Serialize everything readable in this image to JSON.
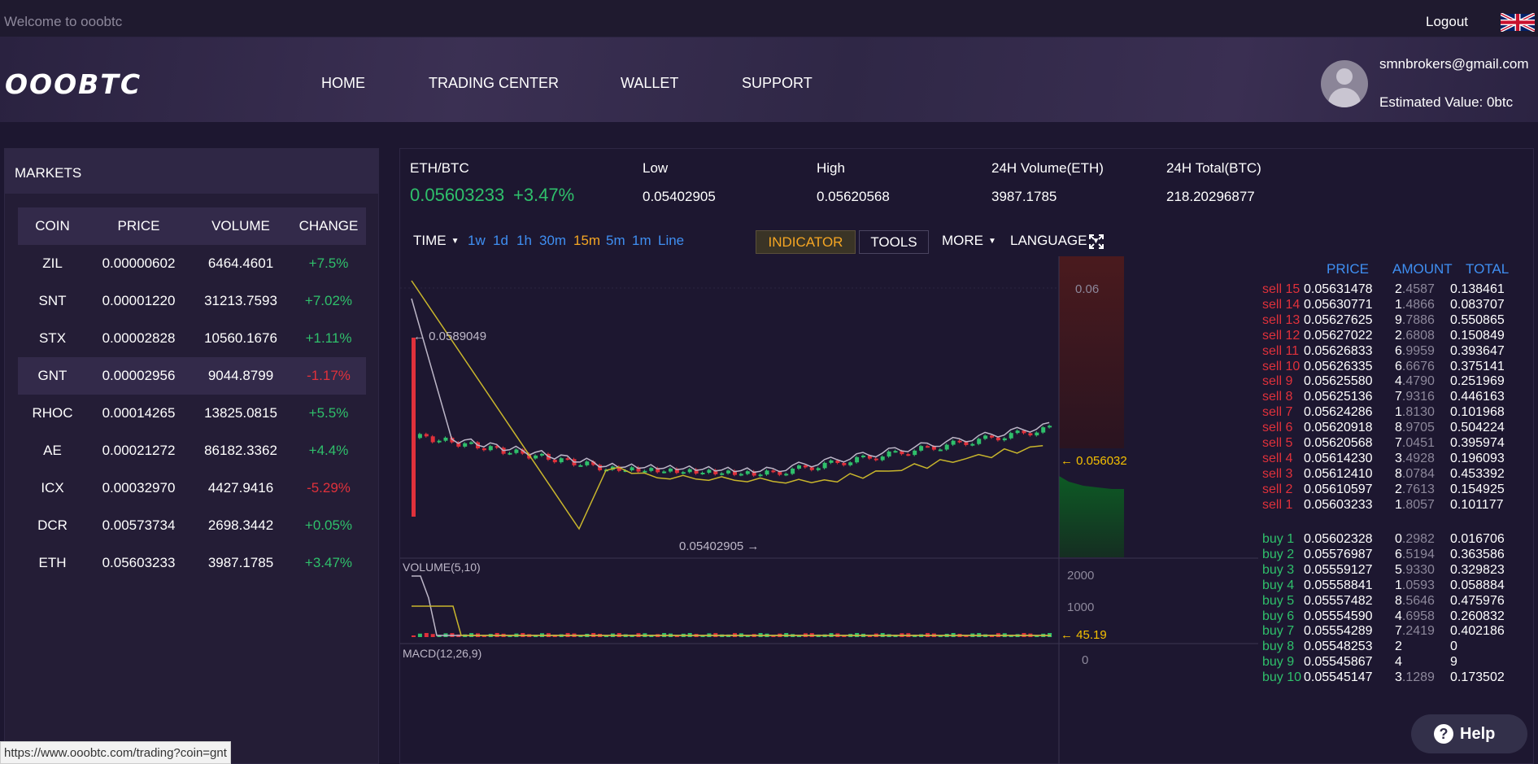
{
  "topbar": {
    "welcome": "Welcome to ooobtc",
    "logout": "Logout"
  },
  "nav": {
    "logo": "OOOBTC",
    "items": [
      "HOME",
      "TRADING CENTER",
      "WALLET",
      "SUPPORT"
    ],
    "user_email": "smnbrokers@gmail.com",
    "estimated_value": "Estimated Value: 0btc"
  },
  "markets": {
    "title": "MARKETS",
    "headers": [
      "COIN",
      "PRICE",
      "VOLUME",
      "CHANGE"
    ],
    "rows": [
      {
        "coin": "ZIL",
        "price": "0.00000602",
        "volume": "6464.4601",
        "change": "+7.5%"
      },
      {
        "coin": "SNT",
        "price": "0.00001220",
        "volume": "31213.7593",
        "change": "+7.02%"
      },
      {
        "coin": "STX",
        "price": "0.00002828",
        "volume": "10560.1676",
        "change": "+1.11%"
      },
      {
        "coin": "GNT",
        "price": "0.00002956",
        "volume": "9044.8799",
        "change": "-1.17%"
      },
      {
        "coin": "RHOC",
        "price": "0.00014265",
        "volume": "13825.0815",
        "change": "+5.5%"
      },
      {
        "coin": "AE",
        "price": "0.00021272",
        "volume": "86182.3362",
        "change": "+4.4%"
      },
      {
        "coin": "ICX",
        "price": "0.00032970",
        "volume": "4427.9416",
        "change": "-5.29%"
      },
      {
        "coin": "DCR",
        "price": "0.00573734",
        "volume": "2698.3442",
        "change": "+0.05%"
      },
      {
        "coin": "ETH",
        "price": "0.05603233",
        "volume": "3987.1785",
        "change": "+3.47%"
      }
    ]
  },
  "ticker": {
    "pair": "ETH/BTC",
    "last": "0.05603233",
    "change": "+3.47%",
    "low_label": "Low",
    "low": "0.05402905",
    "high_label": "High",
    "high": "0.05620568",
    "vol_label": "24H Volume(ETH)",
    "vol": "3987.1785",
    "total_label": "24H Total(BTC)",
    "total": "218.20296877"
  },
  "toolbar": {
    "time": "TIME",
    "intervals": [
      "1w",
      "1d",
      "1h",
      "30m",
      "15m",
      "5m",
      "1m",
      "Line"
    ],
    "indicator": "INDICATOR",
    "tools": "TOOLS",
    "more": "MORE",
    "language": "LANGUAGE"
  },
  "chart": {
    "axis_060": "0.06",
    "max_label": "0.0589049",
    "min_label": "0.05402905",
    "last_label": "0.056032",
    "volume_title": "VOLUME(5,10)",
    "vol_ticks": [
      "2000",
      "1000"
    ],
    "vol_last": "45.19",
    "macd_title": "MACD(12,26,9)",
    "macd_tick": "0"
  },
  "orderbook": {
    "headers": [
      "PRICE",
      "AMOUNT",
      "TOTAL"
    ],
    "sells": [
      {
        "label": "sell 15",
        "price": "0.05631478",
        "amount": "2.4587",
        "total": "0.138461"
      },
      {
        "label": "sell 14",
        "price": "0.05630771",
        "amount": "1.4866",
        "total": "0.083707"
      },
      {
        "label": "sell 13",
        "price": "0.05627625",
        "amount": "9.7886",
        "total": "0.550865"
      },
      {
        "label": "sell 12",
        "price": "0.05627022",
        "amount": "2.6808",
        "total": "0.150849"
      },
      {
        "label": "sell 11",
        "price": "0.05626833",
        "amount": "6.9959",
        "total": "0.393647"
      },
      {
        "label": "sell 10",
        "price": "0.05626335",
        "amount": "6.6676",
        "total": "0.375141"
      },
      {
        "label": "sell 9",
        "price": "0.05625580",
        "amount": "4.4790",
        "total": "0.251969"
      },
      {
        "label": "sell 8",
        "price": "0.05625136",
        "amount": "7.9316",
        "total": "0.446163"
      },
      {
        "label": "sell 7",
        "price": "0.05624286",
        "amount": "1.8130",
        "total": "0.101968"
      },
      {
        "label": "sell 6",
        "price": "0.05620918",
        "amount": "8.9705",
        "total": "0.504224"
      },
      {
        "label": "sell 5",
        "price": "0.05620568",
        "amount": "7.0451",
        "total": "0.395974"
      },
      {
        "label": "sell 4",
        "price": "0.05614230",
        "amount": "3.4928",
        "total": "0.196093"
      },
      {
        "label": "sell 3",
        "price": "0.05612410",
        "amount": "8.0784",
        "total": "0.453392"
      },
      {
        "label": "sell 2",
        "price": "0.05610597",
        "amount": "2.7613",
        "total": "0.154925"
      },
      {
        "label": "sell 1",
        "price": "0.05603233",
        "amount": "1.8057",
        "total": "0.101177"
      }
    ],
    "buys": [
      {
        "label": "buy 1",
        "price": "0.05602328",
        "amount": "0.2982",
        "total": "0.016706"
      },
      {
        "label": "buy 2",
        "price": "0.05576987",
        "amount": "6.5194",
        "total": "0.363586"
      },
      {
        "label": "buy 3",
        "price": "0.05559127",
        "amount": "5.9330",
        "total": "0.329823"
      },
      {
        "label": "buy 4",
        "price": "0.05558841",
        "amount": "1.0593",
        "total": "0.058884"
      },
      {
        "label": "buy 5",
        "price": "0.05557482",
        "amount": "8.5646",
        "total": "0.475976"
      },
      {
        "label": "buy 6",
        "price": "0.05554590",
        "amount": "4.6958",
        "total": "0.260832"
      },
      {
        "label": "buy 7",
        "price": "0.05554289",
        "amount": "7.2419",
        "total": "0.402186"
      },
      {
        "label": "buy 8",
        "price": "0.05548253",
        "amount": "2",
        "total": "0"
      },
      {
        "label": "buy 9",
        "price": "0.05545867",
        "amount": "4",
        "total": "9"
      },
      {
        "label": "buy 10",
        "price": "0.05545147",
        "amount": "3.1289",
        "total": "0.173502"
      }
    ]
  },
  "help": "Help",
  "status_url": "https://www.ooobtc.com/trading?coin=gnt",
  "colors": {
    "up": "#2fc06b",
    "down": "#e0313b",
    "accent": "#3f8ff2",
    "highlight": "#f5a623"
  },
  "icons": [
    "uk-flag-icon",
    "user-avatar-icon",
    "fullscreen-icon",
    "help-icon",
    "chevron-down-icon"
  ]
}
